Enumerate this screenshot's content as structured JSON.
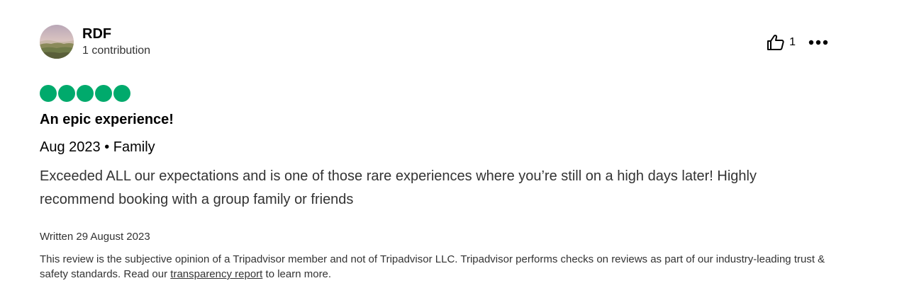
{
  "reviewer": {
    "username": "RDF",
    "contributions": "1 contribution"
  },
  "actions": {
    "helpful_count": "1",
    "helpful_icon": "thumbs-up-icon",
    "more_icon": "more-options-icon"
  },
  "review": {
    "rating": 5,
    "rating_max": 5,
    "rating_color": "#00aa6c",
    "title": "An epic experience!",
    "meta": "Aug 2023 • Family",
    "body": "Exceeded ALL our expectations and is one of those rare experiences where you’re still on a high days later! Highly recommend booking with a group family or friends",
    "written_date": "Written 29 August 2023"
  },
  "disclaimer": {
    "text_before": "This review is the subjective opinion of a Tripadvisor member and not of Tripadvisor LLC. Tripadvisor performs checks on reviews as part of our industry-leading trust & safety standards. Read our ",
    "link_text": "transparency report",
    "text_after": " to learn more."
  }
}
